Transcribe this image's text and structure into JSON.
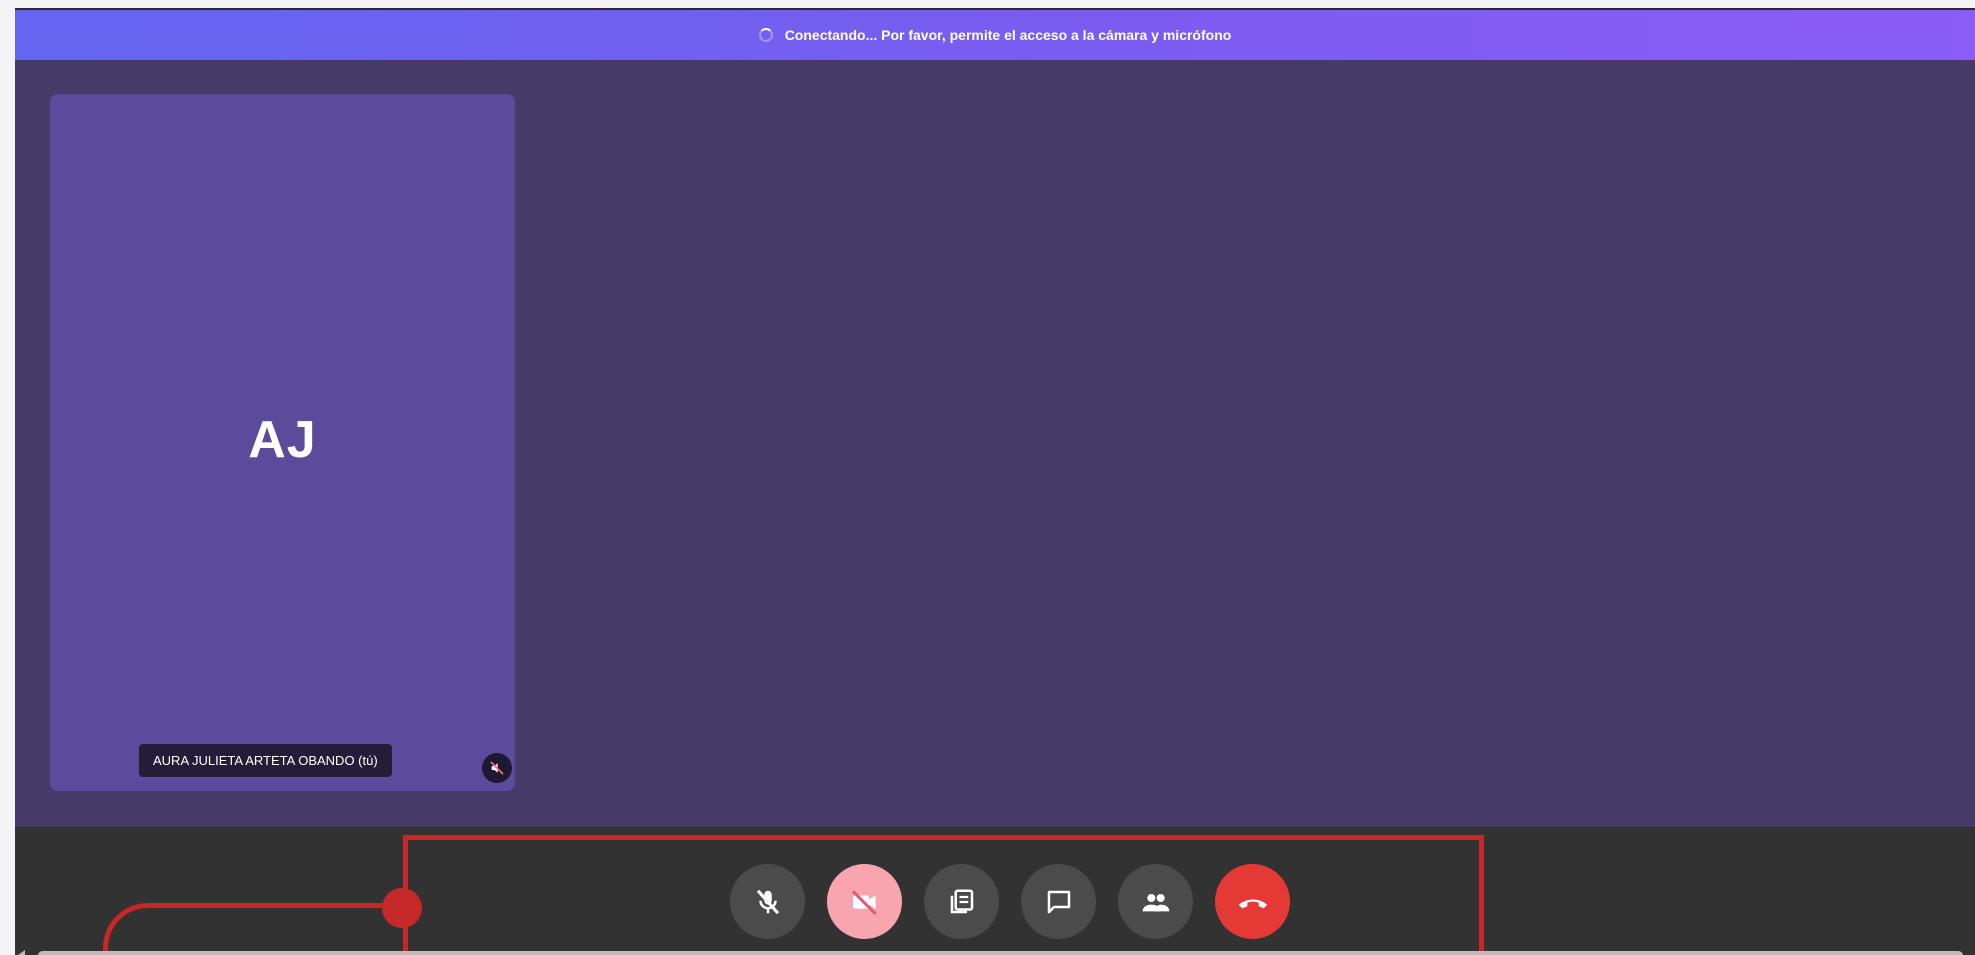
{
  "banner": {
    "status_text": "Conectando... Por favor, permite el acceso a la cámara y micrófono",
    "icon": "spinner-icon"
  },
  "participant": {
    "initials": "AJ",
    "name": "AURA JULIETA ARTETA OBANDO (tú)",
    "status_icon": "muted-speaker-icon"
  },
  "controls": {
    "items": [
      {
        "name": "microphone-toggle-button",
        "icon": "mic-off-icon"
      },
      {
        "name": "camera-toggle-button",
        "icon": "camera-off-icon"
      },
      {
        "name": "present-button",
        "icon": "present-icon"
      },
      {
        "name": "chat-button",
        "icon": "chat-icon"
      },
      {
        "name": "participants-button",
        "icon": "people-icon"
      },
      {
        "name": "hang-up-button",
        "icon": "hang-up-icon"
      }
    ]
  },
  "colors": {
    "stage_bg": "#463b68",
    "tile_bg": "#5b4b9c",
    "controls_bg": "#323232",
    "camera_off": "#f8a5b0",
    "hang_up": "#e53935",
    "annotation": "#c62828"
  }
}
